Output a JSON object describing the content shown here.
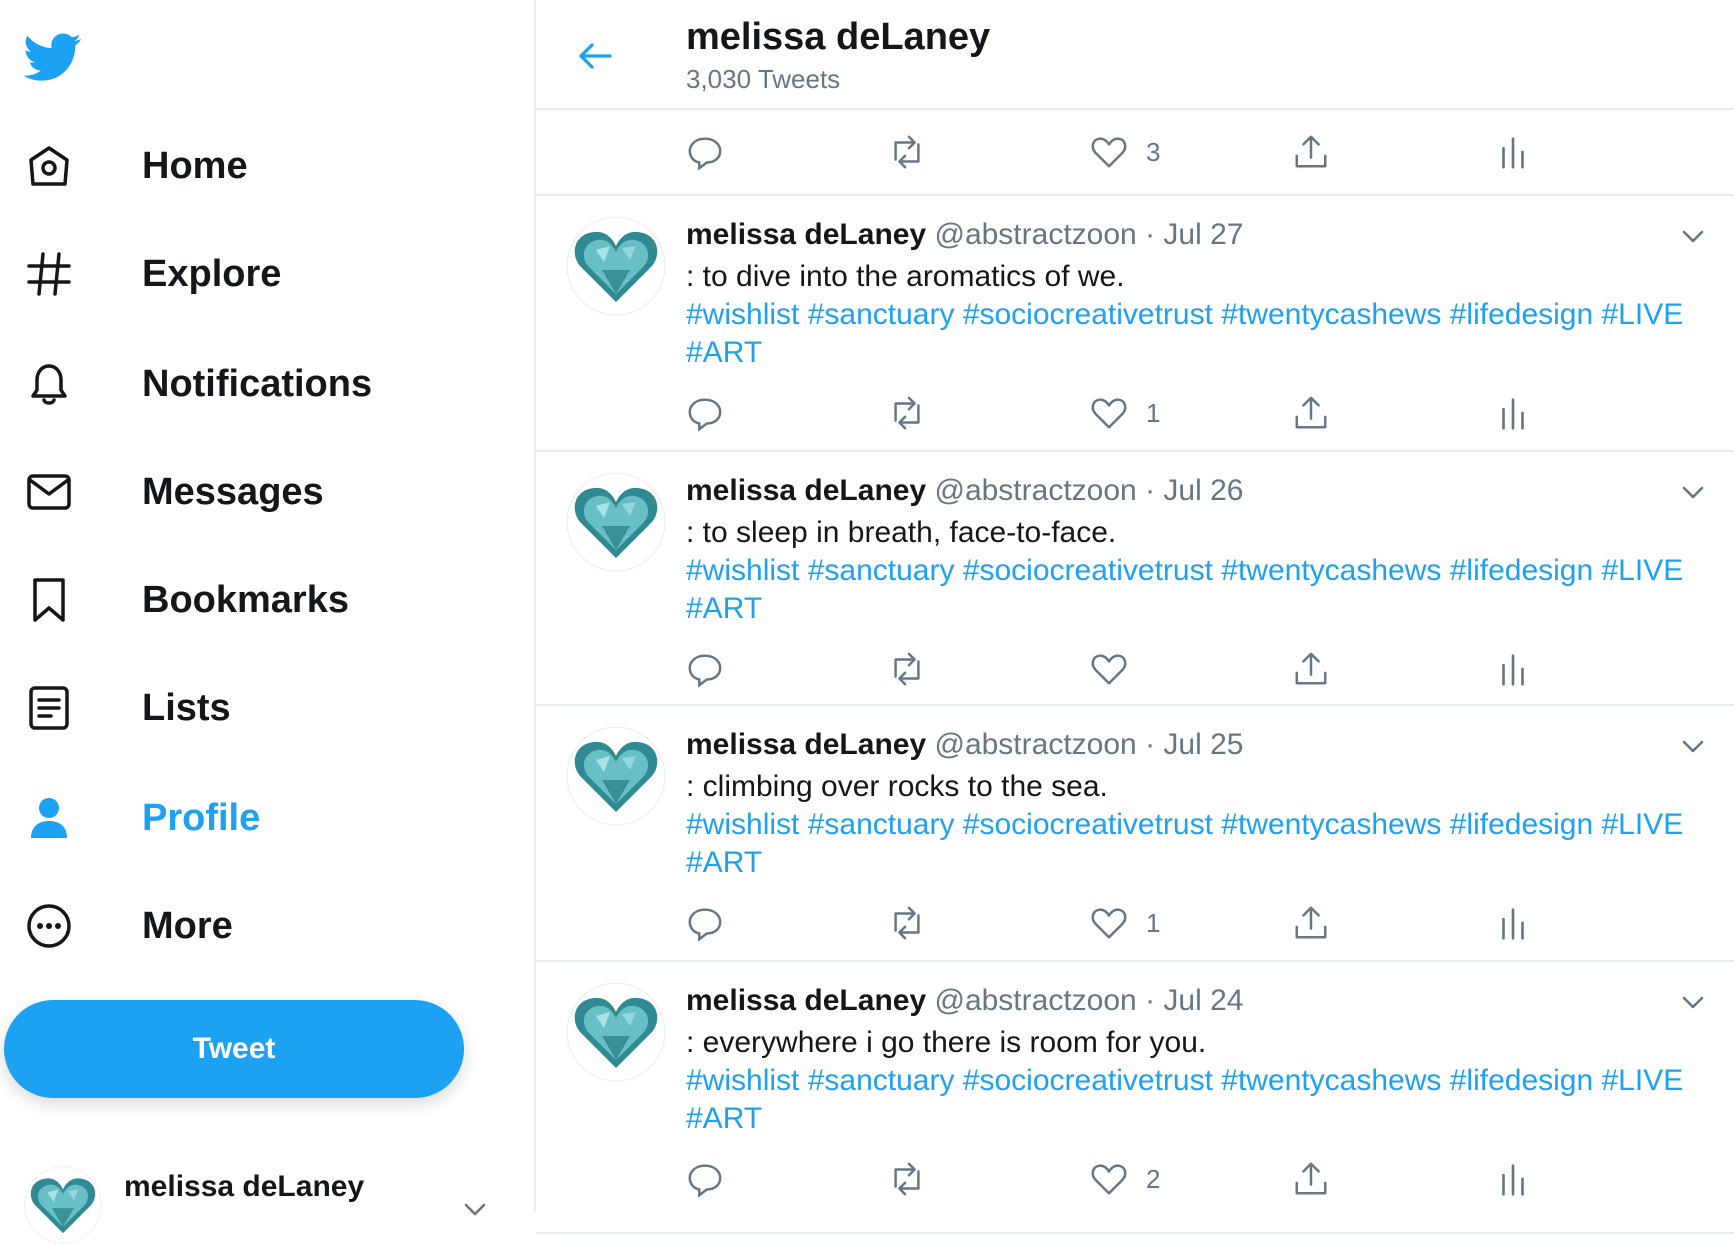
{
  "sidebar": {
    "nav": [
      {
        "label": "Home",
        "icon": "home-icon"
      },
      {
        "label": "Explore",
        "icon": "hashtag-icon"
      },
      {
        "label": "Notifications",
        "icon": "bell-icon"
      },
      {
        "label": "Messages",
        "icon": "envelope-icon"
      },
      {
        "label": "Bookmarks",
        "icon": "bookmark-icon"
      },
      {
        "label": "Lists",
        "icon": "list-icon"
      },
      {
        "label": "Profile",
        "icon": "person-icon",
        "active": true
      },
      {
        "label": "More",
        "icon": "more-icon"
      }
    ],
    "tweet_button": "Tweet",
    "account_name": "melissa deLaney"
  },
  "header": {
    "title": "melissa deLaney",
    "tweet_count": "3,030 Tweets"
  },
  "top_actions": {
    "like_count": "3"
  },
  "tweets": [
    {
      "name": "melissa deLaney",
      "handle": "@abstractzoon",
      "sep": "·",
      "date": "Jul 27",
      "text": ": to dive into the aromatics of we.",
      "hashtags": [
        "#wishlist",
        "#sanctuary",
        "#sociocreativetrust",
        "#twentycashews",
        "#lifedesign",
        "#LIVE",
        "#ART"
      ],
      "like_count": "1"
    },
    {
      "name": "melissa deLaney",
      "handle": "@abstractzoon",
      "sep": "·",
      "date": "Jul 26",
      "text": ": to sleep in breath, face-to-face.",
      "hashtags": [
        "#wishlist",
        "#sanctuary",
        "#sociocreativetrust",
        "#twentycashews",
        "#lifedesign",
        "#LIVE",
        "#ART"
      ],
      "like_count": ""
    },
    {
      "name": "melissa deLaney",
      "handle": "@abstractzoon",
      "sep": "·",
      "date": "Jul 25",
      "text": ": climbing over rocks to the sea.",
      "hashtags": [
        "#wishlist",
        "#sanctuary",
        "#sociocreativetrust",
        "#twentycashews",
        "#lifedesign",
        "#LIVE",
        "#ART"
      ],
      "like_count": "1"
    },
    {
      "name": "melissa deLaney",
      "handle": "@abstractzoon",
      "sep": "·",
      "date": "Jul 24",
      "text": ": everywhere i go there is room for you.",
      "hashtags": [
        "#wishlist",
        "#sanctuary",
        "#sociocreativetrust",
        "#twentycashews",
        "#lifedesign",
        "#LIVE",
        "#ART"
      ],
      "like_count": "2"
    }
  ],
  "colors": {
    "accent": "#1da1f2",
    "text": "#14171a",
    "muted": "#657786",
    "divider": "#e6ecf0",
    "avatar_heart": "#3f9aa3"
  }
}
